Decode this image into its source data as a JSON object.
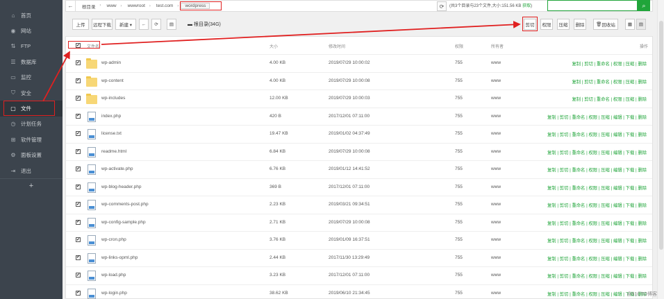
{
  "sidebar": {
    "items": [
      {
        "label": "首页",
        "icon": "home-icon",
        "glyph": "⌂"
      },
      {
        "label": "网站",
        "icon": "globe-icon",
        "glyph": "◉"
      },
      {
        "label": "FTP",
        "icon": "ftp-icon",
        "glyph": "⇅"
      },
      {
        "label": "数据库",
        "icon": "database-icon",
        "glyph": "☰"
      },
      {
        "label": "监控",
        "icon": "monitor-icon",
        "glyph": "▭"
      },
      {
        "label": "安全",
        "icon": "shield-icon",
        "glyph": "⛉"
      },
      {
        "label": "文件",
        "icon": "folder-icon",
        "glyph": "▢",
        "active": true
      },
      {
        "label": "计划任务",
        "icon": "clock-icon",
        "glyph": "◷"
      },
      {
        "label": "软件管理",
        "icon": "apps-icon",
        "glyph": "⊞"
      },
      {
        "label": "面板设置",
        "icon": "gear-icon",
        "glyph": "⚙"
      },
      {
        "label": "退出",
        "icon": "logout-icon",
        "glyph": "⇥"
      }
    ],
    "add_label": "+"
  },
  "pathbar": {
    "back_glyph": "←",
    "crumbs": [
      "根目录",
      "www",
      "wwwroot",
      "test.com",
      "wordpress"
    ],
    "refresh_glyph": "⟳",
    "info_prefix": "共3个目录与23个文件,大小:",
    "info_size": "151.56 KB",
    "info_link": "获取",
    "search_glyph": "⌕"
  },
  "toolbar": {
    "upload": "上传",
    "remote_download": "远程下载",
    "new": "新建 ▾",
    "back": "←",
    "refresh": "⟳",
    "terminal": "▤",
    "disk": "根目录(34G)",
    "cut": "剪切",
    "permission": "权限",
    "compress": "压缩",
    "delete": "删除",
    "recycle": "回收站",
    "grid_view": "▦",
    "list_view": "▤"
  },
  "table": {
    "headers": {
      "name": "文件名",
      "size": "大小",
      "mtime": "修改时间",
      "perm": "权限",
      "owner": "所有者",
      "ops": "操作"
    },
    "rows": [
      {
        "name": "wp-admin",
        "type": "folder",
        "size": "4.00 KB",
        "mtime": "2019/07/29 10:00:02",
        "perm": "755",
        "owner": "www",
        "actions": "复制 | 剪切 | 重命名 | 权限 | 压缩 | 删除"
      },
      {
        "name": "wp-content",
        "type": "folder",
        "size": "4.00 KB",
        "mtime": "2019/07/29 10:00:08",
        "perm": "755",
        "owner": "www",
        "actions": "复制 | 剪切 | 重命名 | 权限 | 压缩 | 删除"
      },
      {
        "name": "wp-includes",
        "type": "folder",
        "size": "12.00 KB",
        "mtime": "2019/07/29 10:00:03",
        "perm": "755",
        "owner": "www",
        "actions": "复制 | 剪切 | 重命名 | 权限 | 压缩 | 删除"
      },
      {
        "name": "index.php",
        "type": "file",
        "size": "420 B",
        "mtime": "2017/12/01 07:11:00",
        "perm": "755",
        "owner": "www",
        "actions": "复制 | 剪切 | 重命名 | 权限 | 压缩 | 编辑 | 下载 | 删除"
      },
      {
        "name": "license.txt",
        "type": "file",
        "size": "19.47 KB",
        "mtime": "2019/01/02 04:37:49",
        "perm": "755",
        "owner": "www",
        "actions": "复制 | 剪切 | 重命名 | 权限 | 压缩 | 编辑 | 下载 | 删除"
      },
      {
        "name": "readme.html",
        "type": "file",
        "size": "6.84 KB",
        "mtime": "2019/07/29 10:00:08",
        "perm": "755",
        "owner": "www",
        "actions": "复制 | 剪切 | 重命名 | 权限 | 压缩 | 编辑 | 下载 | 删除"
      },
      {
        "name": "wp-activate.php",
        "type": "file",
        "size": "6.76 KB",
        "mtime": "2019/01/12 14:41:52",
        "perm": "755",
        "owner": "www",
        "actions": "复制 | 剪切 | 重命名 | 权限 | 压缩 | 编辑 | 下载 | 删除"
      },
      {
        "name": "wp-blog-header.php",
        "type": "file",
        "size": "369 B",
        "mtime": "2017/12/01 07:11:00",
        "perm": "755",
        "owner": "www",
        "actions": "复制 | 剪切 | 重命名 | 权限 | 压缩 | 编辑 | 下载 | 删除"
      },
      {
        "name": "wp-comments-post.php",
        "type": "file",
        "size": "2.23 KB",
        "mtime": "2019/03/21 09:34:51",
        "perm": "755",
        "owner": "www",
        "actions": "复制 | 剪切 | 重命名 | 权限 | 压缩 | 编辑 | 下载 | 删除"
      },
      {
        "name": "wp-config-sample.php",
        "type": "file",
        "size": "2.71 KB",
        "mtime": "2019/07/29 10:00:08",
        "perm": "755",
        "owner": "www",
        "actions": "复制 | 剪切 | 重命名 | 权限 | 压缩 | 编辑 | 下载 | 删除"
      },
      {
        "name": "wp-cron.php",
        "type": "file",
        "size": "3.76 KB",
        "mtime": "2019/01/09 16:37:51",
        "perm": "755",
        "owner": "www",
        "actions": "复制 | 剪切 | 重命名 | 权限 | 压缩 | 编辑 | 下载 | 删除"
      },
      {
        "name": "wp-links-opml.php",
        "type": "file",
        "size": "2.44 KB",
        "mtime": "2017/11/30 13:29:49",
        "perm": "755",
        "owner": "www",
        "actions": "复制 | 剪切 | 重命名 | 权限 | 压缩 | 编辑 | 下载 | 删除"
      },
      {
        "name": "wp-load.php",
        "type": "file",
        "size": "3.23 KB",
        "mtime": "2017/12/01 07:11:00",
        "perm": "755",
        "owner": "www",
        "actions": "复制 | 剪切 | 重命名 | 权限 | 压缩 | 编辑 | 下载 | 删除"
      },
      {
        "name": "wp-login.php",
        "type": "file",
        "size": "38.62 KB",
        "mtime": "2019/06/10 21:34:45",
        "perm": "755",
        "owner": "www",
        "actions": "复制 | 剪切 | 重命名 | 权限 | 压缩 | 编辑 | 下载 | 删除"
      }
    ]
  },
  "checkbox_glyph": "✔",
  "watermark": "@51CTO博客",
  "colors": {
    "accent": "#20a53a",
    "annotation": "#e02020",
    "sidebar_bg": "#3c444d"
  }
}
